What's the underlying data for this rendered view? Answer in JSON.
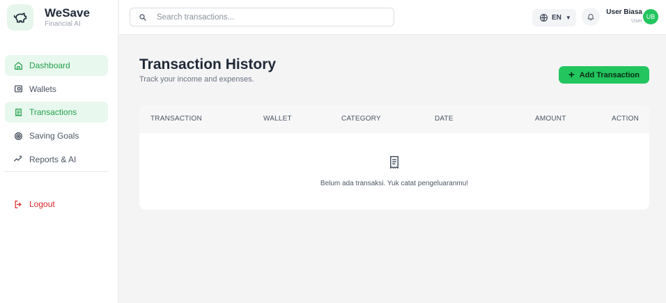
{
  "brand": {
    "name": "WeSave",
    "subtitle": "Financial AI"
  },
  "sidebar": {
    "items": [
      {
        "label": "Dashboard",
        "icon": "home-icon",
        "active": true
      },
      {
        "label": "Wallets",
        "icon": "wallet-icon",
        "active": false
      },
      {
        "label": "Transactions",
        "icon": "receipt-icon",
        "active": true
      },
      {
        "label": "Saving Goals",
        "icon": "target-icon",
        "active": false
      },
      {
        "label": "Reports & AI",
        "icon": "chart-line-icon",
        "active": false
      }
    ],
    "logout_label": "Logout"
  },
  "topbar": {
    "search_placeholder": "Search transactions...",
    "search_value": "",
    "language": "EN",
    "user_name": "User Biasa",
    "user_role": "User",
    "avatar_initials": "UB"
  },
  "main": {
    "title": "Transaction History",
    "subtitle": "Track your income and expenses.",
    "add_button_label": "Add Transaction",
    "columns": [
      "TRANSACTION",
      "WALLET",
      "CATEGORY",
      "DATE",
      "AMOUNT",
      "ACTION"
    ],
    "empty_message": "Belum ada transaksi. Yuk catat pengeluaranmu!"
  },
  "colors": {
    "accent": "#22c55e",
    "accent_text": "#22a04b",
    "active_bg": "#e9f8ee",
    "danger": "#dc2626",
    "background": "#f4f4f5"
  }
}
